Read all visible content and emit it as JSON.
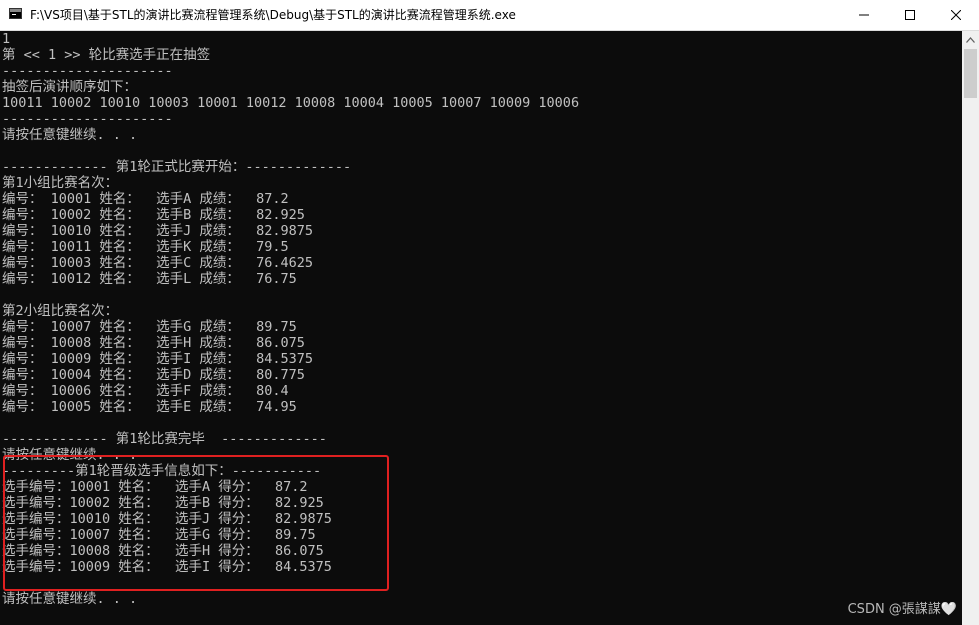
{
  "window": {
    "title": "F:\\VS项目\\基于STL的演讲比赛流程管理系统\\Debug\\基于STL的演讲比赛流程管理系统.exe",
    "icon": "console-app-icon",
    "controls": [
      "minimize-icon",
      "maximize-icon",
      "close-icon"
    ]
  },
  "console": {
    "lines": [
      "1",
      "第 << 1 >> 轮比赛选手正在抽签",
      "---------------------",
      "抽签后演讲顺序如下：",
      "10011 10002 10010 10003 10001 10012 10008 10004 10005 10007 10009 10006",
      "---------------------",
      "请按任意键继续. . .",
      "",
      "------------- 第1轮正式比赛开始：-------------",
      "第1小组比赛名次：",
      "编号： 10001 姓名：  选手A 成绩：  87.2",
      "编号： 10002 姓名：  选手B 成绩：  82.925",
      "编号： 10010 姓名：  选手J 成绩：  82.9875",
      "编号： 10011 姓名：  选手K 成绩：  79.5",
      "编号： 10003 姓名：  选手C 成绩：  76.4625",
      "编号： 10012 姓名：  选手L 成绩：  76.75",
      "",
      "第2小组比赛名次：",
      "编号： 10007 姓名：  选手G 成绩：  89.75",
      "编号： 10008 姓名：  选手H 成绩：  86.075",
      "编号： 10009 姓名：  选手I 成绩：  84.5375",
      "编号： 10004 姓名：  选手D 成绩：  80.775",
      "编号： 10006 姓名：  选手F 成绩：  80.4",
      "编号： 10005 姓名：  选手E 成绩：  74.95",
      "",
      "------------- 第1轮比赛完毕  -------------",
      "请按任意键继续. . .",
      "---------第1轮晋级选手信息如下：-----------",
      "选手编号：10001 姓名：  选手A 得分：  87.2",
      "选手编号：10002 姓名：  选手B 得分：  82.925",
      "选手编号：10010 姓名：  选手J 得分：  82.9875",
      "选手编号：10007 姓名：  选手G 得分：  89.75",
      "选手编号：10008 姓名：  选手H 得分：  86.075",
      "选手编号：10009 姓名：  选手I 得分：  84.5375",
      "",
      "请按任意键继续. . ."
    ],
    "text_color": "#c0c0c0",
    "background": "#0c0c0c"
  },
  "annotation": {
    "highlight_color": "#e02020"
  },
  "watermark": {
    "text": "CSDN @張謀謀🤍"
  }
}
